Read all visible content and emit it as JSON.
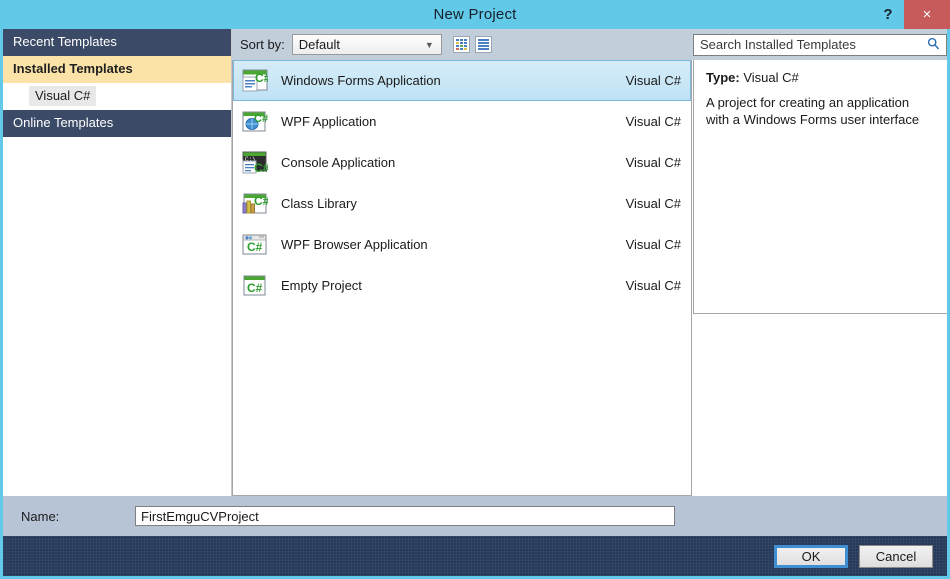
{
  "window": {
    "title": "New Project",
    "help_icon": "help-icon",
    "help_glyph": "?",
    "close_glyph": "×",
    "frame_color": "#63c9e8",
    "close_color": "#c75b5b"
  },
  "sidebar": {
    "items": [
      {
        "label": "Recent Templates",
        "type": "header",
        "active": false
      },
      {
        "label": "Installed Templates",
        "type": "header",
        "active": true
      },
      {
        "label": "Visual C#",
        "type": "child",
        "selected": true
      },
      {
        "label": "Online Templates",
        "type": "header",
        "active": false
      }
    ]
  },
  "toolbar": {
    "sort_label": "Sort by:",
    "sort_value": "Default",
    "sort_caret": "⌄",
    "view_medium_icon": "medium-icons-view-icon",
    "view_list_icon": "list-view-icon"
  },
  "search": {
    "placeholder": "Search Installed Templates",
    "icon": "search-icon"
  },
  "templates": {
    "items": [
      {
        "name": "Windows Forms Application",
        "lang": "Visual C#",
        "icon": "winforms-csharp-icon",
        "selected": true
      },
      {
        "name": "WPF Application",
        "lang": "Visual C#",
        "icon": "wpf-csharp-icon",
        "selected": false
      },
      {
        "name": "Console Application",
        "lang": "Visual C#",
        "icon": "console-csharp-icon",
        "selected": false
      },
      {
        "name": "Class Library",
        "lang": "Visual C#",
        "icon": "classlibrary-csharp-icon",
        "selected": false
      },
      {
        "name": "WPF Browser Application",
        "lang": "Visual C#",
        "icon": "wpfbrowser-csharp-icon",
        "selected": false
      },
      {
        "name": "Empty Project",
        "lang": "Visual C#",
        "icon": "emptyproject-csharp-icon",
        "selected": false
      }
    ]
  },
  "details": {
    "type_label": "Type:",
    "type_value": "Visual C#",
    "description": "A project for creating an application with a Windows Forms user interface"
  },
  "name_row": {
    "label": "Name:",
    "value": "FirstEmguCVProject"
  },
  "footer": {
    "ok_label": "OK",
    "cancel_label": "Cancel"
  }
}
